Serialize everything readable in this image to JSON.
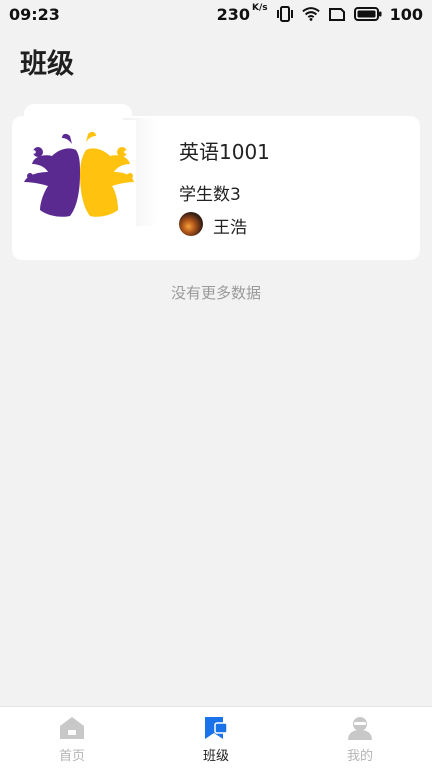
{
  "status_bar": {
    "time": "09:23",
    "net_speed": "230",
    "net_unit": "K/s",
    "battery": "100"
  },
  "page": {
    "title": "班级"
  },
  "class_card": {
    "name": "英语1001",
    "student_count": "学生数3",
    "teacher": "王浩"
  },
  "list_footer": "没有更多数据",
  "nav": {
    "items": [
      {
        "label": "首页",
        "icon": "home-icon"
      },
      {
        "label": "班级",
        "icon": "class-icon"
      },
      {
        "label": "我的",
        "icon": "profile-icon"
      }
    ],
    "active_index": 1,
    "active_color": "#1a73e8",
    "inactive_color": "#c8c8c8"
  }
}
